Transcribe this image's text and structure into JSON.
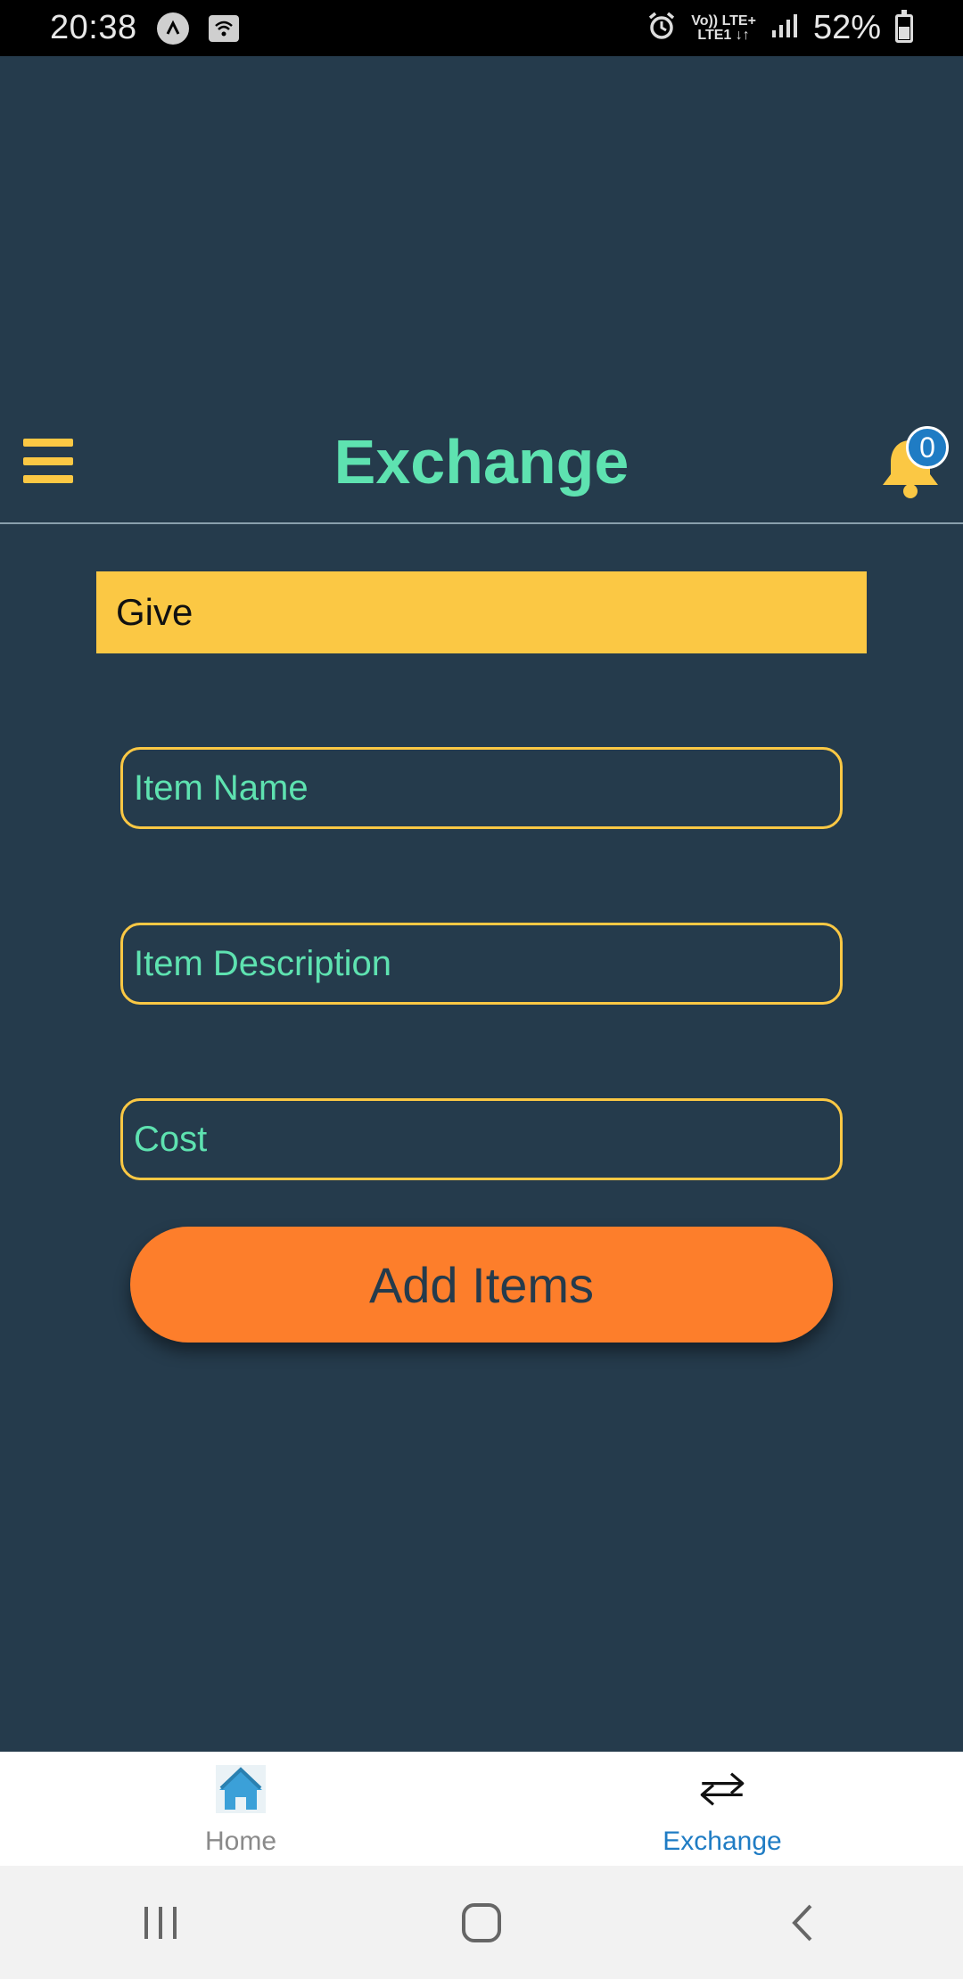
{
  "status_bar": {
    "time": "20:38",
    "network_top": "Vo)) LTE+",
    "network_bottom": "LTE1 ↓↑",
    "battery_percent": "52%"
  },
  "header": {
    "title": "Exchange",
    "notification_count": "0"
  },
  "form": {
    "section_label": "Give",
    "item_name_placeholder": "Item Name",
    "item_description_placeholder": "Item Description",
    "cost_placeholder": "Cost",
    "submit_label": "Add Items"
  },
  "tabbar": {
    "tabs": [
      {
        "label": "Home",
        "icon": "home-icon",
        "active": false
      },
      {
        "label": "Exchange",
        "icon": "exchange-arrows-icon",
        "active": true
      }
    ]
  },
  "colors": {
    "background": "#253b4c",
    "accent_yellow": "#fbc844",
    "accent_mint": "#5ee2b0",
    "button_orange": "#fd7e2b",
    "active_tab_blue": "#1f7cc4"
  }
}
